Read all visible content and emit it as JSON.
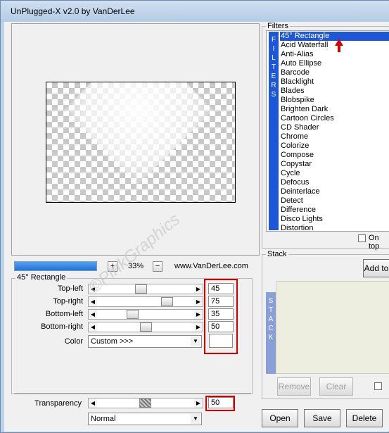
{
  "window": {
    "title": "UnPlugged-X v2.0 by VanDerLee"
  },
  "preview": {
    "zoom": "33%",
    "zoom_in": "+",
    "zoom_out": "−",
    "url": "www.VanDerLee.com",
    "progress_pct": 100
  },
  "params": {
    "group_title": "45° Rectangle",
    "sliders": [
      {
        "label": "Top-left",
        "value": "45",
        "pct": 45
      },
      {
        "label": "Top-right",
        "value": "75",
        "pct": 75
      },
      {
        "label": "Bottom-left",
        "value": "35",
        "pct": 35
      },
      {
        "label": "Bottom-right",
        "value": "50",
        "pct": 50
      }
    ],
    "color_label": "Color",
    "color_value": "Custom >>>",
    "color_swatch": "#ffffff"
  },
  "transparency": {
    "label": "Transparency",
    "value": "50",
    "pct": 50,
    "blend": "Normal"
  },
  "filters": {
    "group_title": "Filters",
    "sidebar_letters": [
      "F",
      "I",
      "L",
      "T",
      "E",
      "R",
      "S"
    ],
    "items": [
      "45° Rectangle",
      "Acid Waterfall",
      "Anti-Alias",
      "Auto Ellipse",
      "Barcode",
      "Blacklight",
      "Blades",
      "Blobspike",
      "Brighten Dark",
      "Cartoon Circles",
      "CD Shader",
      "Chrome",
      "Colorize",
      "Compose",
      "Copystar",
      "Cycle",
      "Defocus",
      "Deinterlace",
      "Detect",
      "Difference",
      "Disco Lights",
      "Distortion"
    ],
    "selected_index": 0,
    "on_top_label": "On top"
  },
  "stack": {
    "group_title": "Stack",
    "sidebar_letters": [
      "S",
      "T",
      "A",
      "C",
      "K"
    ],
    "add_label": "Add to",
    "remove_label": "Remove",
    "clear_label": "Clear"
  },
  "buttons": {
    "open": "Open",
    "save": "Save",
    "delete": "Delete"
  },
  "watermark": "©PinkGraphics",
  "colors": {
    "selection": "#1d57d8",
    "annotation": "#d40000",
    "progress": "#1c74d8"
  }
}
